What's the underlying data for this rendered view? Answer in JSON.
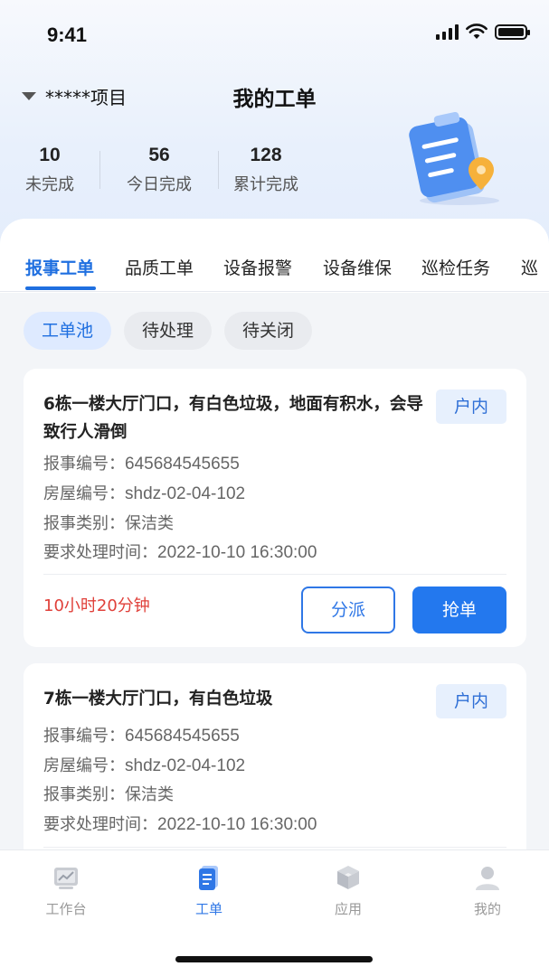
{
  "status_bar": {
    "time": "9:41"
  },
  "header": {
    "project": "*****项目",
    "title": "我的工单",
    "stats": [
      {
        "value": "10",
        "label": "未完成"
      },
      {
        "value": "56",
        "label": "今日完成"
      },
      {
        "value": "128",
        "label": "累计完成"
      }
    ]
  },
  "tabs": [
    "报事工单",
    "品质工单",
    "设备报警",
    "设备维保",
    "巡检任务",
    "巡"
  ],
  "active_tab": "报事工单",
  "filters": [
    "工单池",
    "待处理",
    "待关闭"
  ],
  "active_filter": "工单池",
  "orders": [
    {
      "title": "6栋一楼大厅门口，有白色垃圾，地面有积水，会导致行人滑倒",
      "tag": "户内",
      "fields": [
        {
          "label": "报事编号：",
          "value": "645684545655"
        },
        {
          "label": "房屋编号：",
          "value": "shdz-02-04-102"
        },
        {
          "label": "报事类别：",
          "value": "保洁类"
        },
        {
          "label": "要求处理时间：",
          "value": "2022-10-10 16:30:00"
        }
      ],
      "countdown": "10小时20分钟",
      "dispatch_label": "分派",
      "grab_label": "抢单"
    },
    {
      "title": "7栋一楼大厅门口，有白色垃圾",
      "tag": "户内",
      "fields": [
        {
          "label": "报事编号：",
          "value": "645684545655"
        },
        {
          "label": "房屋编号：",
          "value": "shdz-02-04-102"
        },
        {
          "label": "报事类别：",
          "value": "保洁类"
        },
        {
          "label": "要求处理时间：",
          "value": "2022-10-10 16:30:00"
        }
      ]
    }
  ],
  "tabbar": [
    {
      "label": "工作台",
      "icon": "workbench-icon"
    },
    {
      "label": "工单",
      "icon": "work-order-icon"
    },
    {
      "label": "应用",
      "icon": "apps-cube-icon"
    },
    {
      "label": "我的",
      "icon": "profile-icon"
    }
  ],
  "active_tabbar": "工单",
  "colors": {
    "accent": "#2378ee",
    "danger": "#e0403a",
    "tag_bg": "#e7f0fd"
  }
}
